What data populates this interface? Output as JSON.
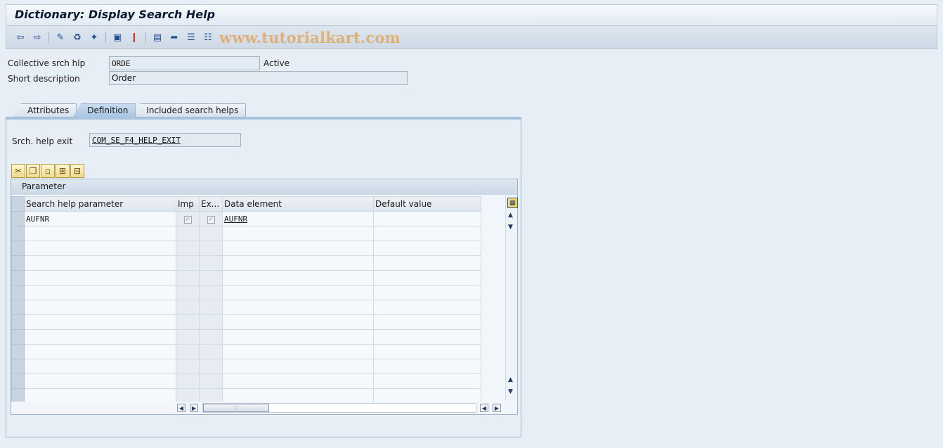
{
  "window": {
    "title": "Dictionary: Display Search Help"
  },
  "toolbar": {
    "icons": [
      "back-icon",
      "forward-icon",
      "display-change-icon",
      "check-icon",
      "activate-icon",
      "where-used-icon",
      "graphic-icon",
      "object-list-icon",
      "navigate-icon",
      "hierarchy-icon",
      "test-icon",
      "documentation-icon",
      "info-icon"
    ],
    "watermark": "www.tutorialkart.com"
  },
  "header": {
    "collective_label": "Collective srch hlp",
    "collective_value": "ORDE",
    "status": "Active",
    "short_desc_label": "Short description",
    "short_desc_value": "Order"
  },
  "tabs": [
    {
      "label": "Attributes",
      "active": false
    },
    {
      "label": "Definition",
      "active": true
    },
    {
      "label": "Included search helps",
      "active": false
    }
  ],
  "definition": {
    "exit_label": "Srch. help exit",
    "exit_value": "COM_SE_F4_HELP_EXIT"
  },
  "grid": {
    "title": "Parameter",
    "columns": [
      "Search help parameter",
      "Imp",
      "Ex...",
      "Data element",
      "Default value"
    ],
    "rows": [
      {
        "param": "AUFNR",
        "imp": true,
        "exp": true,
        "data_element": "AUFNR",
        "default": ""
      },
      {
        "param": "",
        "imp": null,
        "exp": null,
        "data_element": "",
        "default": ""
      },
      {
        "param": "",
        "imp": null,
        "exp": null,
        "data_element": "",
        "default": ""
      },
      {
        "param": "",
        "imp": null,
        "exp": null,
        "data_element": "",
        "default": ""
      },
      {
        "param": "",
        "imp": null,
        "exp": null,
        "data_element": "",
        "default": ""
      },
      {
        "param": "",
        "imp": null,
        "exp": null,
        "data_element": "",
        "default": ""
      },
      {
        "param": "",
        "imp": null,
        "exp": null,
        "data_element": "",
        "default": ""
      },
      {
        "param": "",
        "imp": null,
        "exp": null,
        "data_element": "",
        "default": ""
      },
      {
        "param": "",
        "imp": null,
        "exp": null,
        "data_element": "",
        "default": ""
      },
      {
        "param": "",
        "imp": null,
        "exp": null,
        "data_element": "",
        "default": ""
      },
      {
        "param": "",
        "imp": null,
        "exp": null,
        "data_element": "",
        "default": ""
      },
      {
        "param": "",
        "imp": null,
        "exp": null,
        "data_element": "",
        "default": ""
      },
      {
        "param": "",
        "imp": null,
        "exp": null,
        "data_element": "",
        "default": ""
      }
    ]
  }
}
